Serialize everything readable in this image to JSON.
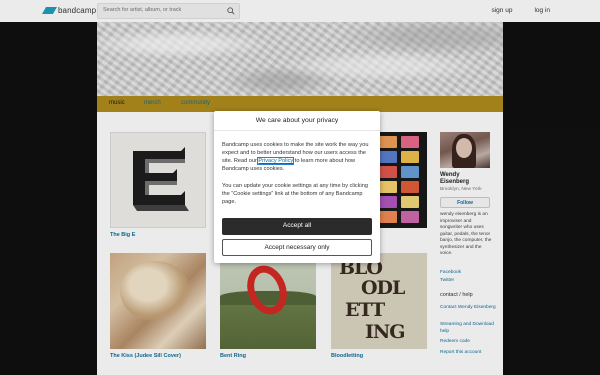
{
  "topbar": {
    "logo_text": "bandcamp",
    "search_placeholder": "Search for artist, album, or track",
    "signup": "sign up",
    "login": "log in"
  },
  "nav": {
    "tabs": [
      "music",
      "merch",
      "community"
    ]
  },
  "albums": [
    {
      "title": "The Big E"
    },
    {
      "title": ""
    },
    {
      "title": ""
    },
    {
      "title": "The Kiss (Judee Sill Cover)"
    },
    {
      "title": "Bent Ring"
    },
    {
      "title": "Bloodletting"
    }
  ],
  "artist": {
    "name_line1": "Wendy",
    "name_line2": "Eisenberg",
    "location": "Brooklyn, New York",
    "follow_label": "Follow",
    "bio": "wendy eisenberg is an improviser and songwriter who uses guitar, pedals, the tenor banjo, the computer, the synthesizer and the voice.",
    "links": [
      "Facebook",
      "Twitter"
    ],
    "contact_heading": "contact / help",
    "help_links": [
      "Contact Wendy Eisenberg",
      "Streaming and Download help",
      "Redeem code",
      "Report this account"
    ]
  },
  "cookie_modal": {
    "title": "We care about your privacy",
    "p1_before": "Bandcamp uses cookies to make the site work the way you expect and to better understand how our users access the site. Read our ",
    "p1_link": "Privacy Policy",
    "p1_after": " to learn more about how Bandcamp uses cookies.",
    "p2": "You can update your cookie settings at any time by clicking the “Cookie settings” link at the bottom of any Bandcamp page.",
    "accept_all": "Accept all",
    "accept_necessary": "Accept necessary only"
  },
  "colors": {
    "accent_link": "#0f6f99",
    "nav_bar": "#b08d1e",
    "logo": "#1da0c3"
  },
  "album_art_text": {
    "bloodletting": [
      "BLO",
      "ODL",
      "ETT",
      "ING"
    ]
  }
}
